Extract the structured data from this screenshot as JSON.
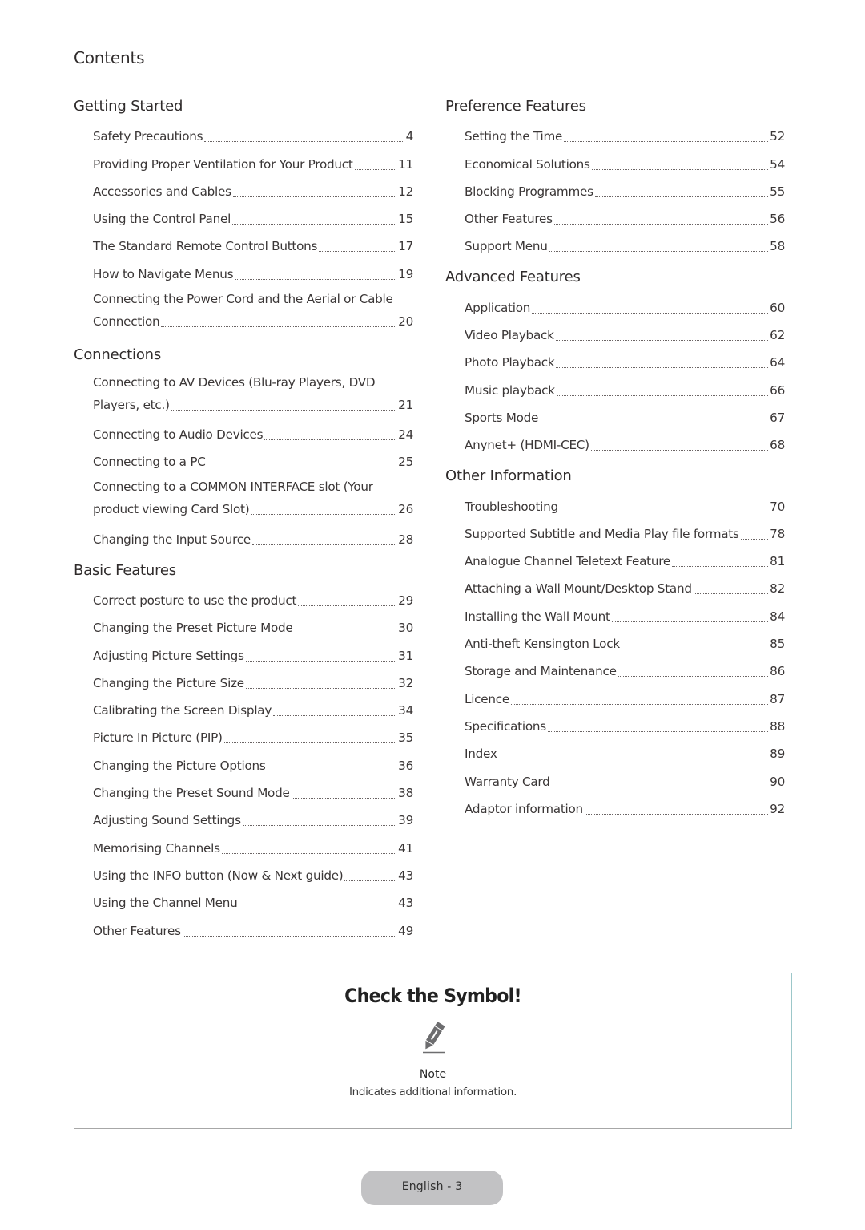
{
  "page": {
    "title": "Contents"
  },
  "columns": {
    "left": [
      {
        "title": "Getting Started",
        "entries": [
          {
            "text": "Safety Precautions",
            "page": "4"
          },
          {
            "text": "Providing Proper Ventilation for Your Product",
            "page": "11"
          },
          {
            "text": "Accessories and Cables",
            "page": "12"
          },
          {
            "text": "Using the Control Panel",
            "page": "15"
          },
          {
            "text": "The Standard Remote Control Buttons",
            "page": "17"
          },
          {
            "text": "How to Navigate Menus",
            "page": "19"
          },
          {
            "line1": "Connecting the Power Cord and the Aerial or Cable",
            "text": "Connection",
            "page": "20"
          }
        ]
      },
      {
        "title": "Connections",
        "entries": [
          {
            "line1": "Connecting to AV Devices (Blu-ray Players, DVD",
            "text": "Players, etc.)",
            "page": "21"
          },
          {
            "text": "Connecting to Audio Devices",
            "page": "24"
          },
          {
            "text": "Connecting to a PC",
            "page": "25"
          },
          {
            "line1": "Connecting to a COMMON INTERFACE slot (Your",
            "text": "product viewing Card Slot)",
            "page": "26"
          },
          {
            "text": "Changing the Input Source",
            "page": "28"
          }
        ]
      },
      {
        "title": "Basic Features",
        "entries": [
          {
            "text": "Correct posture to use the product",
            "page": "29"
          },
          {
            "text": "Changing the Preset Picture Mode",
            "page": "30"
          },
          {
            "text": "Adjusting Picture Settings",
            "page": "31"
          },
          {
            "text": "Changing the Picture Size",
            "page": "32"
          },
          {
            "text": "Calibrating the Screen Display",
            "page": "34"
          },
          {
            "text": "Picture In Picture (PIP)",
            "page": "35"
          },
          {
            "text": "Changing the Picture Options",
            "page": "36"
          },
          {
            "text": "Changing the Preset Sound Mode",
            "page": "38"
          },
          {
            "text": "Adjusting Sound Settings",
            "page": "39"
          },
          {
            "text": "Memorising Channels",
            "page": "41"
          },
          {
            "text": "Using the INFO button (Now & Next guide)",
            "page": "43"
          },
          {
            "text": "Using the Channel Menu",
            "page": "43"
          },
          {
            "text": "Other Features",
            "page": "49"
          }
        ]
      }
    ],
    "right": [
      {
        "title": "Preference Features",
        "entries": [
          {
            "text": "Setting the Time",
            "page": "52"
          },
          {
            "text": "Economical Solutions",
            "page": "54"
          },
          {
            "text": "Blocking Programmes",
            "page": "55"
          },
          {
            "text": "Other Features",
            "page": "56"
          },
          {
            "text": "Support Menu",
            "page": "58"
          }
        ]
      },
      {
        "title": "Advanced Features",
        "entries": [
          {
            "text": "Application",
            "page": "60"
          },
          {
            "text": "Video Playback",
            "page": "62"
          },
          {
            "text": "Photo Playback",
            "page": "64"
          },
          {
            "text": "Music playback",
            "page": "66"
          },
          {
            "text": "Sports Mode",
            "page": "67"
          },
          {
            "text": "Anynet+ (HDMI-CEC)",
            "page": "68"
          }
        ]
      },
      {
        "title": "Other Information",
        "entries": [
          {
            "text": "Troubleshooting",
            "page": "70"
          },
          {
            "text": "Supported Subtitle and Media Play file formats",
            "page": "78"
          },
          {
            "text": "Analogue Channel Teletext Feature",
            "page": "81"
          },
          {
            "text": "Attaching a Wall Mount/Desktop Stand",
            "page": "82"
          },
          {
            "text": "Installing the Wall Mount",
            "page": "84"
          },
          {
            "text": "Anti-theft Kensington Lock",
            "page": "85"
          },
          {
            "text": "Storage and Maintenance",
            "page": "86"
          },
          {
            "text": "Licence",
            "page": "87"
          },
          {
            "text": "Specifications",
            "page": "88"
          },
          {
            "text": "Index",
            "page": "89"
          },
          {
            "text": "Warranty Card",
            "page": "90"
          },
          {
            "text": "Adaptor information",
            "page": "92"
          }
        ]
      }
    ]
  },
  "symbol_box": {
    "title": "Check the Symbol!",
    "icon": "pencil-note-icon",
    "label": "Note",
    "description": "Indicates additional information."
  },
  "footer": {
    "page_label": "English - 3"
  },
  "colors": {
    "text": "#3a3636",
    "footer_pill": "#c2c2c4",
    "icon": "#6d6d6f"
  }
}
